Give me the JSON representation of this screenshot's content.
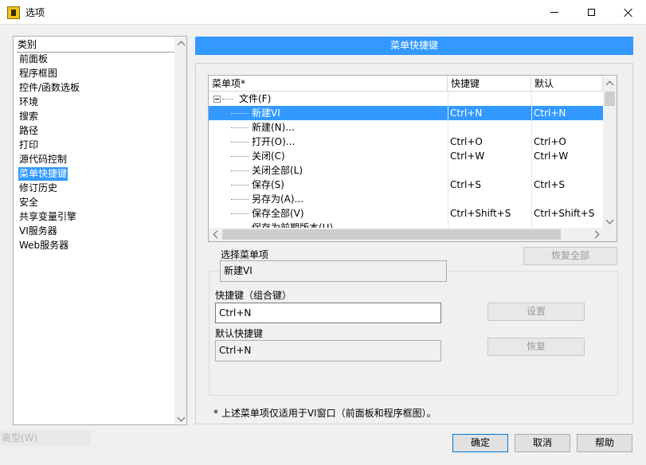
{
  "window": {
    "title": "选项",
    "icons": {
      "app": "labview-icon",
      "min": "minimize-icon",
      "max": "maximize-icon",
      "close": "close-icon"
    }
  },
  "categories": {
    "header": "类别",
    "items": [
      "前面板",
      "程序框图",
      "控件/函数选板",
      "环境",
      "搜索",
      "路径",
      "打印",
      "源代码控制",
      "菜单快捷键",
      "修订历史",
      "安全",
      "共享变量引擎",
      "VI服务器",
      "Web服务器"
    ],
    "selected": "菜单快捷键"
  },
  "panel": {
    "title": "菜单快捷键"
  },
  "table": {
    "columns": [
      "菜单项*",
      "快捷键",
      "默认"
    ],
    "rows": [
      {
        "item": "文件(F)",
        "shortcut": "",
        "default": ""
      },
      {
        "item": "新建VI",
        "shortcut": "Ctrl+N",
        "default": "Ctrl+N"
      },
      {
        "item": "新建(N)...",
        "shortcut": "",
        "default": ""
      },
      {
        "item": "打开(O)...",
        "shortcut": "Ctrl+O",
        "default": "Ctrl+O"
      },
      {
        "item": "关闭(C)",
        "shortcut": "Ctrl+W",
        "default": "Ctrl+W"
      },
      {
        "item": "关闭全部(L)",
        "shortcut": "",
        "default": ""
      },
      {
        "item": "保存(S)",
        "shortcut": "Ctrl+S",
        "default": "Ctrl+S"
      },
      {
        "item": "另存为(A)...",
        "shortcut": "",
        "default": ""
      },
      {
        "item": "保存全部(V)",
        "shortcut": "Ctrl+Shift+S",
        "default": "Ctrl+Shift+S"
      },
      {
        "item": "保存为前期版本(U)...",
        "shortcut": "",
        "default": ""
      }
    ],
    "selected_row": "新建VI"
  },
  "selection": {
    "label": "选择菜单项",
    "value": "新建VI",
    "restore_all": "恢复全部",
    "shortcut_label": "快捷键（组合键）",
    "shortcut_value": "Ctrl+N",
    "set_button": "设置",
    "default_label": "默认快捷键",
    "default_value": "Ctrl+N",
    "restore_button": "恢复"
  },
  "footnote": "* 上述菜单项仅适用于VI窗口（前面板和程序框图）。",
  "buttons": {
    "ok": "确定",
    "cancel": "取消",
    "help": "帮助"
  },
  "ghost": "离型(W)"
}
